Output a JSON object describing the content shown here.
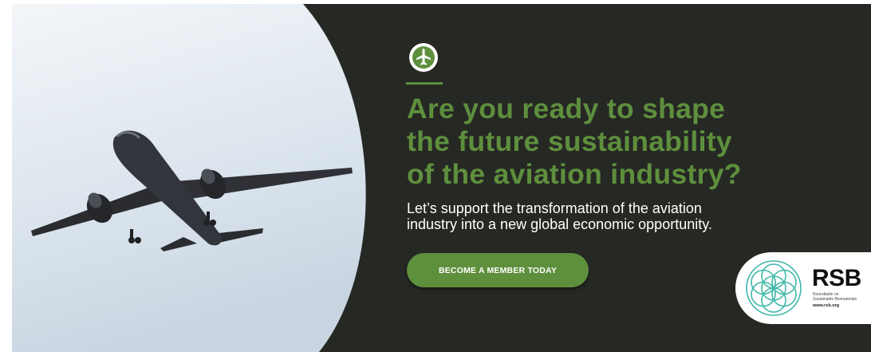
{
  "banner": {
    "headline_lines": [
      "Are you ready to shape",
      "the future sustainability",
      "of the aviation industry?"
    ],
    "subtext_lines": [
      "Let’s support the transformation of the aviation",
      "industry into a new global economic opportunity."
    ],
    "cta_label": "BECOME A MEMBER TODAY",
    "badge_icon": "airplane-icon"
  },
  "logo": {
    "name": "RSB",
    "subtitle_lines": [
      "Roundtable on",
      "Sustainable Biomaterials"
    ],
    "url": "www.rsb.org",
    "icon": "flower-of-life-icon"
  },
  "colors": {
    "background": "#262824",
    "accent_green": "#5e8f3d",
    "logo_teal": "#3fb8a8",
    "text_white": "#ffffff"
  }
}
